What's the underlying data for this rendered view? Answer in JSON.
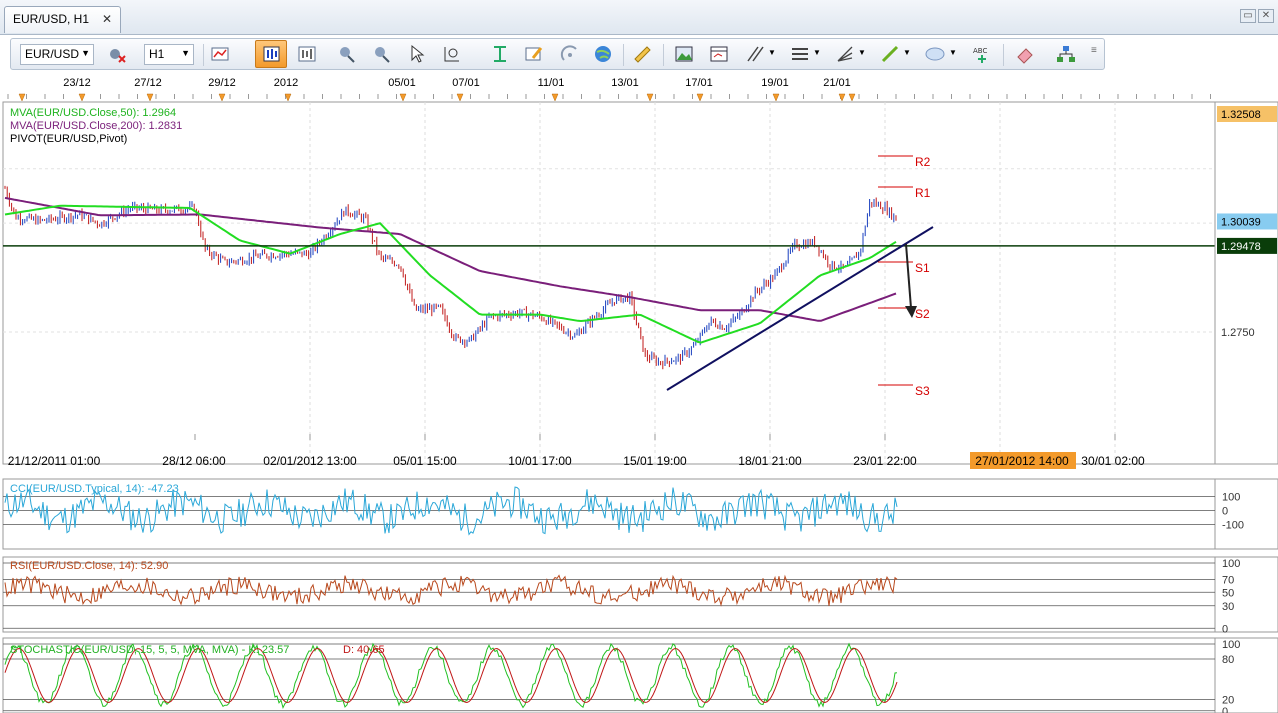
{
  "tab": {
    "title": "EUR/USD, H1",
    "close": "✕"
  },
  "toolbar": {
    "symbol": "EUR/USD",
    "timeframe": "H1"
  },
  "top_dates": [
    "23/12",
    "27/12",
    "29/12",
    "2012",
    "05/01",
    "07/01",
    "11/01",
    "13/01",
    "17/01",
    "19/01",
    "21/01"
  ],
  "bottom_dates": [
    "21/12/2011 01:00",
    "28/12 06:00",
    "02/01/2012 13:00",
    "05/01 15:00",
    "10/01 17:00",
    "15/01 19:00",
    "18/01 21:00",
    "23/01 22:00",
    "30/01 02:00"
  ],
  "cursor_date": "27/01/2012 14:00",
  "legend": {
    "mva50": "MVA(EUR/USD.Close,50): 1.2964",
    "mva200": "MVA(EUR/USD.Close,200): 1.2831",
    "pivot": "PIVOT(EUR/USD,Pivot)"
  },
  "price_scale": {
    "top": "1.32508",
    "current": "1.30039",
    "line": "1.29478",
    "mid": "1.2750"
  },
  "pivot_levels": [
    "R2",
    "R1",
    "S1",
    "S2",
    "S3"
  ],
  "indicators": {
    "cci": {
      "label": "CCI(EUR/USD.Typical, 14): -47.23",
      "scale": [
        "100",
        "0",
        "-100"
      ]
    },
    "rsi": {
      "label": "RSI(EUR/USD.Close, 14): 52.90",
      "scale": [
        "100",
        "70",
        "50",
        "30",
        "0"
      ]
    },
    "stoch": {
      "label_k": "STOCHASTIC(EUR/USD, 15, 5, 5, MVA, MVA) -  K: 23.57",
      "label_d": "D: 40.65",
      "scale": [
        "100",
        "80",
        "20",
        "0"
      ]
    }
  },
  "colors": {
    "mva50": "#22dd22",
    "mva200": "#7a1f7a",
    "bull": "#1a3fbf",
    "bear": "#c01818",
    "pivot": "#d40000",
    "cci": "#2aa7d8",
    "rsi": "#b8481c",
    "accent": "#f39a2b"
  }
}
